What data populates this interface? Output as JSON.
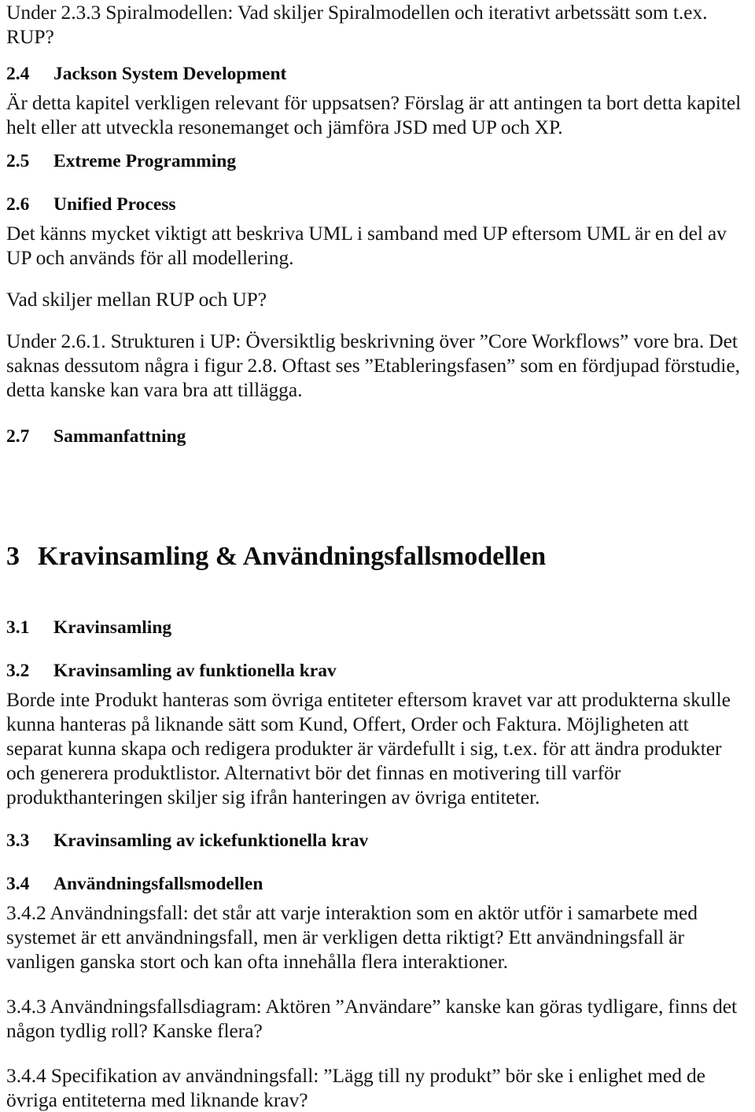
{
  "document": {
    "language": "sv",
    "page_background": "#ffffff",
    "text_color": "#151515"
  },
  "blocks": {
    "intro_note": "Under 2.3.3 Spiralmodellen: Vad skiljer Spiralmodellen och iterativt arbetssätt som t.ex. RUP?",
    "h_2_4": {
      "number": "2.4",
      "title": "Jackson System Development"
    },
    "p_2_4": "Är detta kapitel verkligen relevant för uppsatsen? Förslag är att antingen ta bort detta kapitel helt eller att utveckla resonemanget och jämföra JSD med UP och XP.",
    "h_2_5": {
      "number": "2.5",
      "title": "Extreme Programming"
    },
    "h_2_6": {
      "number": "2.6",
      "title": "Unified Process"
    },
    "p_2_6": "Det känns mycket viktigt att beskriva UML i samband med UP eftersom UML är en del av UP och används för all modellering.",
    "q_rup_up": "Vad skiljer mellan RUP och UP?",
    "p_2_6_1": "Under 2.6.1. Strukturen i UP: Översiktlig beskrivning över ”Core Workflows” vore bra. Det saknas dessutom några i figur 2.8. Oftast ses ”Etableringsfasen” som en fördjupad förstudie, detta kanske kan vara bra att tillägga.",
    "h_2_7": {
      "number": "2.7",
      "title": "Sammanfattning"
    },
    "h_3": {
      "number": "3",
      "title": "Kravinsamling & Användningsfallsmodellen"
    },
    "h_3_1": {
      "number": "3.1",
      "title": "Kravinsamling"
    },
    "h_3_2": {
      "number": "3.2",
      "title": "Kravinsamling av funktionella krav"
    },
    "p_3_2": "Borde inte Produkt hanteras som övriga entiteter eftersom kravet var att produkterna skulle kunna hanteras på liknande sätt som Kund, Offert, Order och Faktura. Möjligheten att separat kunna skapa och redigera produkter är värdefullt i sig, t.ex. för att ändra produkter och generera produktlistor. Alternativt bör det finnas en motivering till varför produkthanteringen skiljer sig ifrån hanteringen av övriga entiteter.",
    "h_3_3": {
      "number": "3.3",
      "title": "Kravinsamling av ickefunktionella krav"
    },
    "h_3_4": {
      "number": "3.4",
      "title": "Användningsfallsmodellen"
    },
    "p_3_4_2": "3.4.2 Användningsfall: det står att varje interaktion som en aktör utför i samarbete med systemet är ett användningsfall, men är verkligen detta riktigt? Ett användningsfall är vanligen ganska stort och kan ofta innehålla flera interaktioner.",
    "p_3_4_3": "3.4.3 Användningsfallsdiagram: Aktören ”Användare” kanske kan göras tydligare, finns det någon tydlig roll? Kanske flera?",
    "p_3_4_4": "3.4.4 Specifikation av användningsfall: ”Lägg till ny produkt” bör ske i enlighet med de övriga entiteterna med liknande krav?"
  }
}
